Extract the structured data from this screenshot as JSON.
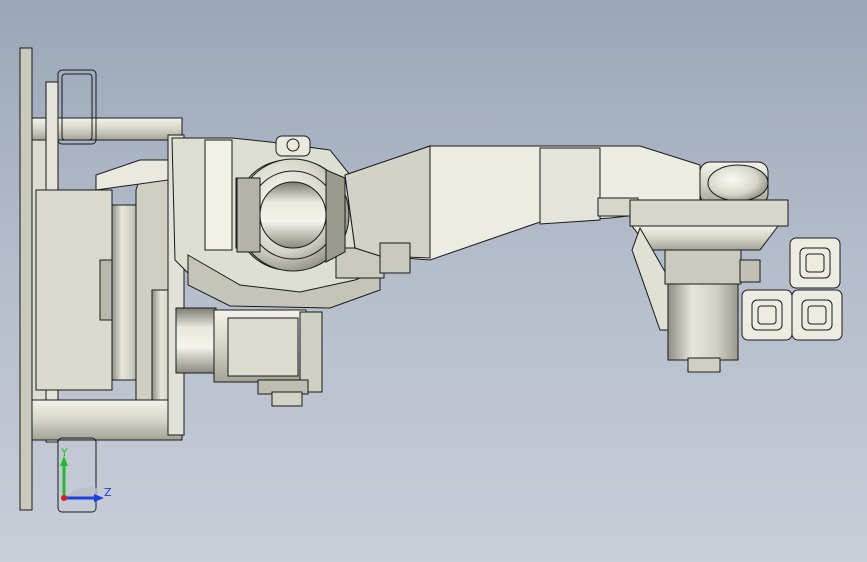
{
  "scene": {
    "model": "robot-arm",
    "view": "side"
  },
  "triad": {
    "y_label": "Y",
    "z_label": "Z",
    "y_color": "#1fbf2a",
    "z_color": "#1b3fe0"
  },
  "colors": {
    "background_top": "#9aa6b8",
    "background_bottom": "#c9ced8",
    "part_fill": "#d8d8cc",
    "part_light": "#ecece2",
    "part_dark": "#8e8e84",
    "edge": "#1a1a1a",
    "highlight_edge": "#3a2e7a"
  }
}
